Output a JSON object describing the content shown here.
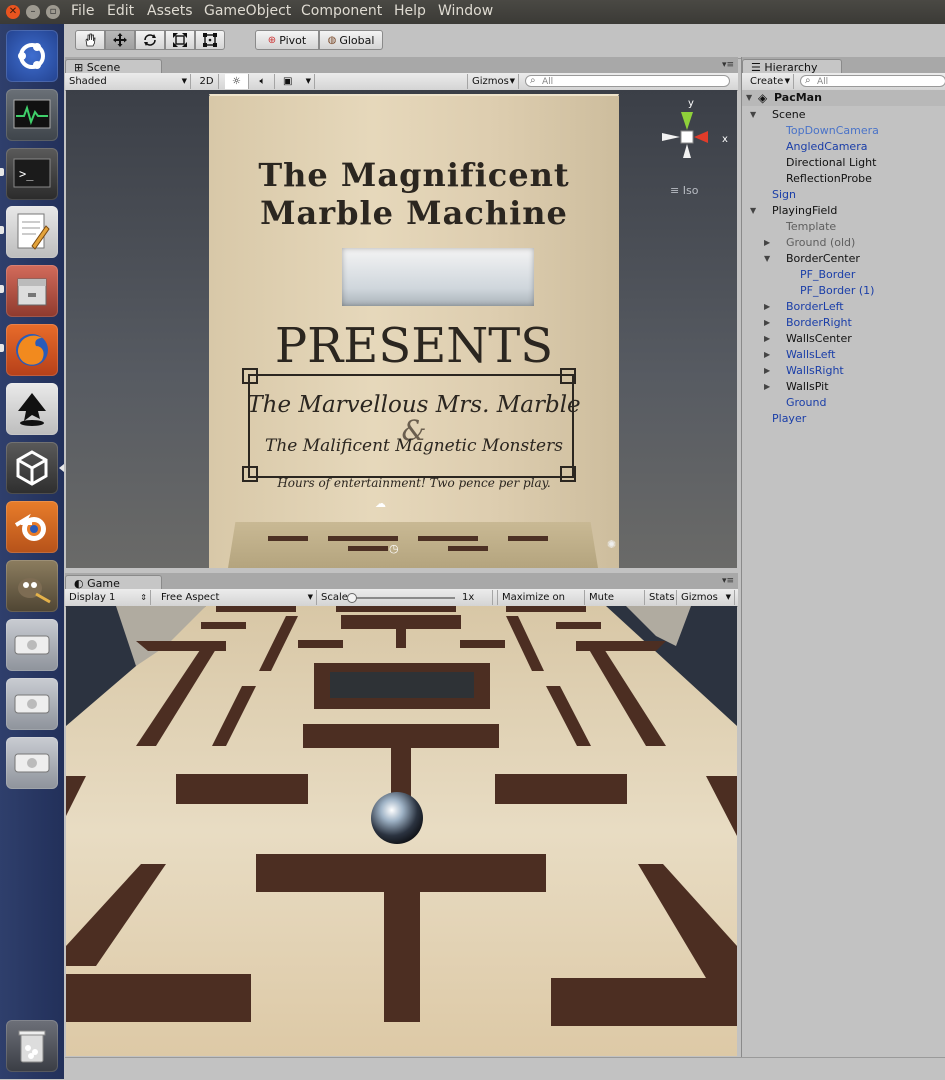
{
  "menubar": {
    "items": [
      "File",
      "Edit",
      "Assets",
      "GameObject",
      "Component",
      "Help",
      "Window"
    ]
  },
  "launcher": {
    "apps": [
      "ubuntu-dash-icon",
      "system-monitor-icon",
      "terminal-icon",
      "text-editor-icon",
      "file-manager-icon",
      "firefox-icon",
      "inkscape-icon",
      "unity-icon",
      "blender-icon",
      "gimp-icon",
      "disk-drive-icon",
      "disk-drive-icon",
      "disk-drive-icon",
      "trash-icon"
    ]
  },
  "toolbar": {
    "tools": [
      "hand-tool-icon",
      "move-tool-icon",
      "rotate-tool-icon",
      "scale-tool-icon",
      "rect-tool-icon"
    ],
    "pivot_label": "Pivot",
    "global_label": "Global"
  },
  "scene": {
    "tab_label": "Scene",
    "shading": "Shaded",
    "mode_2d": "2D",
    "gizmos": "Gizmos",
    "search_placeholder": "All",
    "iso_label": "Iso",
    "axis_y": "y",
    "axis_x": "x",
    "sign": {
      "title_line1": "The Magnificent",
      "title_line2": "Marble Machine",
      "presents": "PRESENTS",
      "line1": "The Marvellous Mrs. Marble",
      "amp": "&",
      "line2": "The Malificent Magnetic Monsters",
      "tagline": "Hours of entertainment! Two pence per play."
    }
  },
  "game": {
    "tab_label": "Game",
    "display": "Display 1",
    "aspect": "Free Aspect",
    "scale_label": "Scale",
    "scale_value": "1x",
    "maximize": "Maximize on Play",
    "mute": "Mute audio",
    "stats": "Stats",
    "gizmos": "Gizmos",
    "scale_fraction": 0.0
  },
  "hierarchy": {
    "tab_label": "Hierarchy",
    "create_label": "Create",
    "search_placeholder": "All",
    "scene_name": "PacMan",
    "items": [
      {
        "label": "Scene",
        "color": "black",
        "arrow": "down"
      },
      {
        "label": "TopDownCamera",
        "color": "lightblue",
        "arrow": ""
      },
      {
        "label": "AngledCamera",
        "color": "blue",
        "arrow": ""
      },
      {
        "label": "Directional Light",
        "color": "black",
        "arrow": ""
      },
      {
        "label": "ReflectionProbe",
        "color": "black",
        "arrow": ""
      },
      {
        "label": "Sign",
        "color": "blue",
        "arrow": ""
      },
      {
        "label": "PlayingField",
        "color": "black",
        "arrow": "down"
      },
      {
        "label": "Template",
        "color": "grey",
        "arrow": ""
      },
      {
        "label": "Ground (old)",
        "color": "grey",
        "arrow": "right"
      },
      {
        "label": "BorderCenter",
        "color": "black",
        "arrow": "down"
      },
      {
        "label": "PF_Border",
        "color": "blue",
        "arrow": ""
      },
      {
        "label": "PF_Border (1)",
        "color": "blue",
        "arrow": ""
      },
      {
        "label": "BorderLeft",
        "color": "blue",
        "arrow": "right"
      },
      {
        "label": "BorderRight",
        "color": "blue",
        "arrow": "right"
      },
      {
        "label": "WallsCenter",
        "color": "black",
        "arrow": "right"
      },
      {
        "label": "WallsLeft",
        "color": "blue",
        "arrow": "right"
      },
      {
        "label": "WallsRight",
        "color": "blue",
        "arrow": "right"
      },
      {
        "label": "WallsPit",
        "color": "black",
        "arrow": "right"
      },
      {
        "label": "Ground",
        "color": "blue",
        "arrow": ""
      },
      {
        "label": "Player",
        "color": "blue",
        "arrow": ""
      }
    ]
  }
}
